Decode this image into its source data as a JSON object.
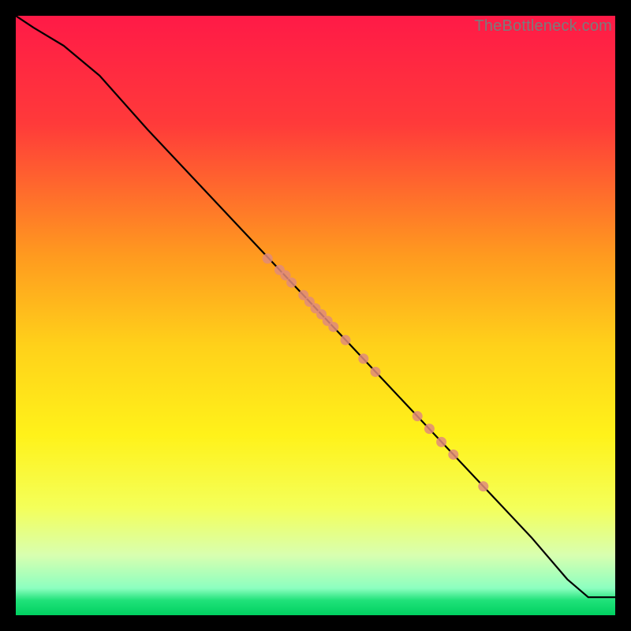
{
  "watermark": "TheBottleneck.com",
  "chart_data": {
    "type": "line",
    "title": "",
    "xlabel": "",
    "ylabel": "",
    "xlim": [
      0,
      100
    ],
    "ylim": [
      0,
      100
    ],
    "grid": false,
    "gradient_stops": [
      {
        "offset": 0,
        "color": "#ff1a47"
      },
      {
        "offset": 0.18,
        "color": "#ff3a3a"
      },
      {
        "offset": 0.4,
        "color": "#ff9a1f"
      },
      {
        "offset": 0.55,
        "color": "#ffd11a"
      },
      {
        "offset": 0.7,
        "color": "#fff21a"
      },
      {
        "offset": 0.82,
        "color": "#f4ff59"
      },
      {
        "offset": 0.9,
        "color": "#d8ffb0"
      },
      {
        "offset": 0.955,
        "color": "#8cffc0"
      },
      {
        "offset": 0.975,
        "color": "#20e27a"
      },
      {
        "offset": 1.0,
        "color": "#00d060"
      }
    ],
    "series": [
      {
        "name": "curve",
        "type": "line",
        "x": [
          0,
          3,
          8,
          14,
          22,
          30,
          38,
          46,
          54,
          62,
          70,
          78,
          86,
          92,
          95.5,
          100
        ],
        "y": [
          100,
          98,
          95,
          90,
          81,
          72.5,
          64,
          55.5,
          47,
          38.5,
          30,
          21.5,
          13,
          6,
          3,
          3
        ]
      },
      {
        "name": "markers",
        "type": "scatter",
        "x": [
          42,
          44,
          45,
          46,
          48,
          49,
          50,
          51,
          52,
          53,
          55,
          58,
          60,
          67,
          69,
          71,
          73,
          78
        ],
        "y": [
          59.5,
          57.6,
          56.7,
          55.5,
          53.4,
          52.3,
          51.2,
          50.2,
          49.1,
          48.1,
          45.9,
          42.8,
          40.6,
          33.2,
          31.1,
          28.9,
          26.8,
          21.5
        ],
        "color": "#e08b7a"
      }
    ]
  }
}
